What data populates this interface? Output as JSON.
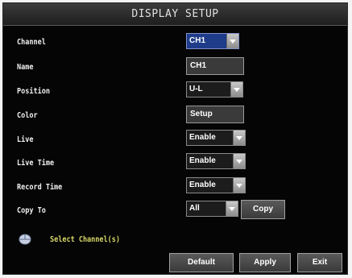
{
  "window": {
    "title": "DISPLAY SETUP"
  },
  "form": {
    "channel": {
      "label": "Channel",
      "value": "CH1"
    },
    "name": {
      "label": "Name",
      "value": "CH1"
    },
    "position": {
      "label": "Position",
      "value": "U-L"
    },
    "color": {
      "label": "Color",
      "button": "Setup"
    },
    "live": {
      "label": "Live",
      "value": "Enable"
    },
    "live_time": {
      "label": "Live Time",
      "value": "Enable"
    },
    "record_time": {
      "label": "Record Time",
      "value": "Enable"
    },
    "copy_to": {
      "label": "Copy To",
      "value": "All",
      "button": "Copy"
    }
  },
  "hint": {
    "icon": "mouse-icon",
    "text": "Select Channel(s)"
  },
  "buttons": {
    "default": "Default",
    "apply": "Apply",
    "exit": "Exit"
  },
  "colors": {
    "background": "#050505",
    "selected_combo": "#1e3c8a",
    "hint_text": "#d8d86a"
  }
}
